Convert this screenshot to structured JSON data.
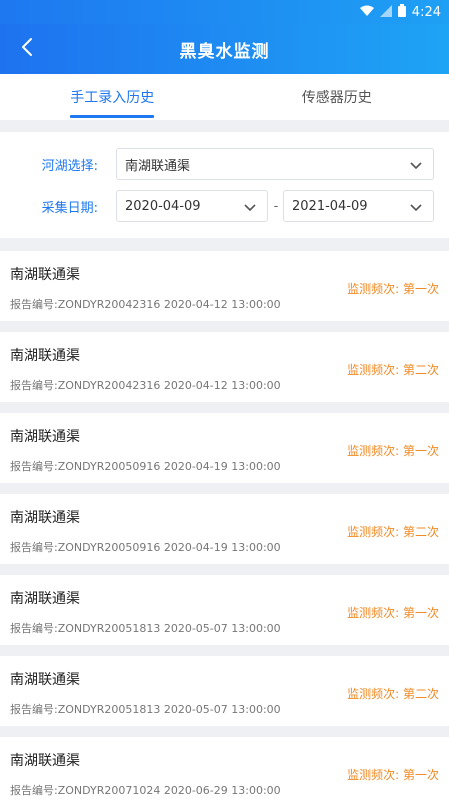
{
  "status_bar": {
    "time": "4:24"
  },
  "header": {
    "title": "黑臭水监测"
  },
  "tabs": [
    {
      "label": "手工录入历史",
      "active": true
    },
    {
      "label": "传感器历史",
      "active": false
    }
  ],
  "filter": {
    "river_label": "河湖选择:",
    "river_value": "南湖联通渠",
    "date_label": "采集日期:",
    "start_date": "2020-04-09",
    "end_date": "2021-04-09",
    "separator": "-"
  },
  "records": [
    {
      "name": "南湖联通渠",
      "report": "报告编号:ZONDYR20042316  2020-04-12 13:00:00",
      "freq": "监测频次: 第一次"
    },
    {
      "name": "南湖联通渠",
      "report": "报告编号:ZONDYR20042316  2020-04-12 13:00:00",
      "freq": "监测频次: 第二次"
    },
    {
      "name": "南湖联通渠",
      "report": "报告编号:ZONDYR20050916  2020-04-19 13:00:00",
      "freq": "监测频次: 第一次"
    },
    {
      "name": "南湖联通渠",
      "report": "报告编号:ZONDYR20050916  2020-04-19 13:00:00",
      "freq": "监测频次: 第二次"
    },
    {
      "name": "南湖联通渠",
      "report": "报告编号:ZONDYR20051813  2020-05-07 13:00:00",
      "freq": "监测频次: 第一次"
    },
    {
      "name": "南湖联通渠",
      "report": "报告编号:ZONDYR20051813  2020-05-07 13:00:00",
      "freq": "监测频次: 第二次"
    },
    {
      "name": "南湖联通渠",
      "report": "报告编号:ZONDYR20071024  2020-06-29 13:00:00",
      "freq": "监测频次: 第一次"
    }
  ],
  "colors": {
    "primary": "#1e78f0",
    "accent": "#f08a24"
  }
}
